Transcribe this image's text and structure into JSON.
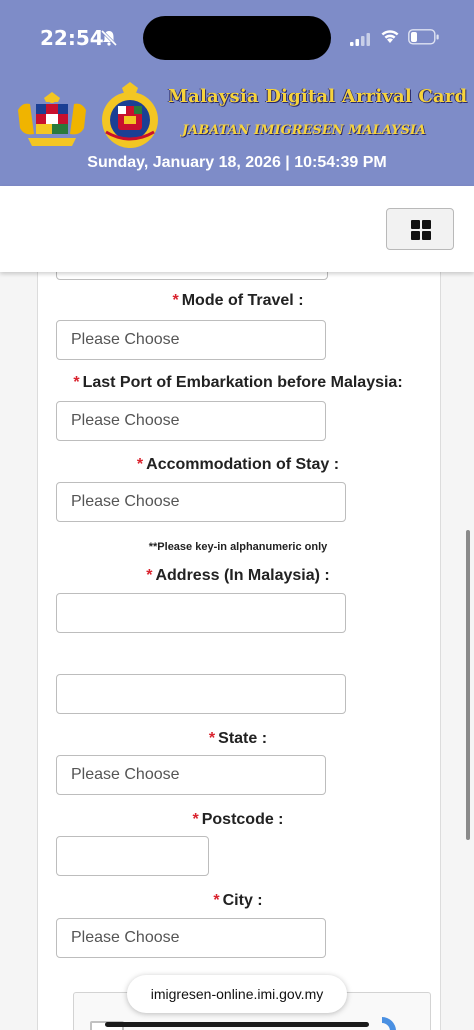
{
  "status_bar": {
    "time": "22:54",
    "icons": [
      "bell-slash-icon",
      "signal-icon",
      "wifi-icon",
      "battery-icon"
    ]
  },
  "header": {
    "title": "Malaysia Digital Arrival Card",
    "subtitle": "JABATAN IMIGRESEN MALAYSIA",
    "datetime": "Sunday, January 18, 2026 | 10:54:39 PM",
    "background_color": "#7e8cc8",
    "title_color": "#f6d33c"
  },
  "navbar": {
    "menu_icon": "grid-menu-icon"
  },
  "form": {
    "required_marker": "*",
    "mode_of_travel": {
      "label": "Mode of Travel :",
      "value": "Please Choose"
    },
    "last_port": {
      "label": "Last Port of Embarkation before Malaysia:",
      "value": "Please Choose"
    },
    "accommodation": {
      "label": "Accommodation of Stay :",
      "value": "Please Choose"
    },
    "address_note": "**Please key-in alphanumeric only",
    "address": {
      "label": "Address (In Malaysia) :",
      "line1": "",
      "line2": ""
    },
    "state": {
      "label": "State :",
      "value": "Please Choose"
    },
    "postcode": {
      "label": "Postcode :",
      "value": ""
    },
    "city": {
      "label": "City :",
      "value": "Please Choose"
    },
    "required_color": "#d9232e"
  },
  "browser": {
    "url": "imigresen-online.imi.gov.my"
  }
}
